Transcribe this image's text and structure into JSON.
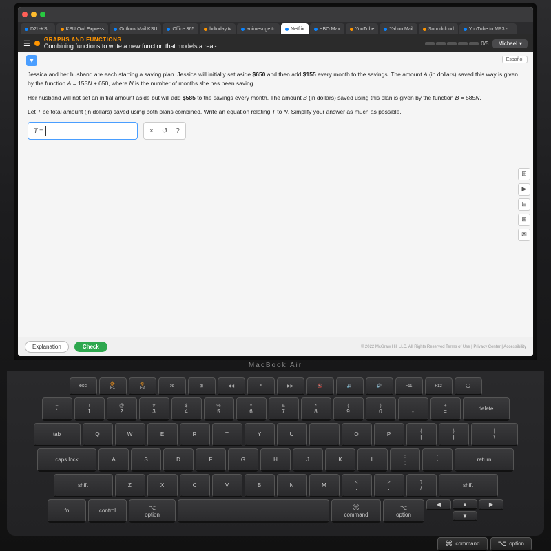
{
  "browser": {
    "tabs": [
      {
        "id": "d2l",
        "label": "D2L-KSU",
        "active": false,
        "dot": "blue"
      },
      {
        "id": "ksu",
        "label": "KSU Owl Express",
        "active": false,
        "dot": "orange"
      },
      {
        "id": "outlook",
        "label": "Outlook Mail KSU",
        "active": false,
        "dot": "blue"
      },
      {
        "id": "office",
        "label": "Office 365",
        "active": false,
        "dot": "blue"
      },
      {
        "id": "hd",
        "label": "hdtoday.tv",
        "active": false,
        "dot": "orange"
      },
      {
        "id": "anime",
        "label": "animesuge.to",
        "active": false,
        "dot": "blue"
      },
      {
        "id": "netflix",
        "label": "Netflix",
        "active": true,
        "dot": "blue"
      },
      {
        "id": "hbo",
        "label": "HBO Max",
        "active": false,
        "dot": "blue"
      },
      {
        "id": "yt",
        "label": "YouTube",
        "active": false,
        "dot": "orange"
      },
      {
        "id": "yahoo",
        "label": "Yahoo Mail",
        "active": false,
        "dot": "blue"
      },
      {
        "id": "sc",
        "label": "Soundcloud",
        "active": false,
        "dot": "orange"
      },
      {
        "id": "ytmp3",
        "label": "YouTube to MP3 -…",
        "active": false,
        "dot": "blue"
      }
    ]
  },
  "site": {
    "nav_section": "GRAPHS AND FUNCTIONS",
    "nav_title": "Combining functions to write a new function that models a real-...",
    "progress_filled": 0,
    "progress_total": 5,
    "progress_label": "0/5",
    "user_name": "Michael",
    "espanol_label": "Español"
  },
  "problem": {
    "expand_icon": "▾",
    "para1": "Jessica and her husband are each starting a saving plan. Jessica will initially set aside $650 and then add $155 every month to the savings. The amount A (in dollars) saved this way is given by the function A = 155N + 650, where N is the number of months she has been saving.",
    "para2": "Her husband will not set an initial amount aside but will add $585 to the savings every month. The amount B (in dollars) saved using this plan is given by the function B = 585N.",
    "para3": "Let T be total amount (in dollars) saved using both plans combined. Write an equation relating T to N. Simplify your answer as much as possible.",
    "equation_prefix": "T =",
    "equation_value": "",
    "symbol_x": "×",
    "symbol_undo": "↺",
    "symbol_help": "?"
  },
  "bottom": {
    "explanation_label": "Explanation",
    "check_label": "Check",
    "copyright": "© 2022 McGraw Hill LLC. All Rights Reserved   Terms of Use  |  Privacy Center  |  Accessibility"
  },
  "macbook": {
    "label": "MacBook Air"
  },
  "keyboard": {
    "fn_row": [
      "esc",
      "",
      "",
      "",
      "",
      "",
      "",
      "",
      "",
      "",
      "",
      "",
      "",
      "",
      ""
    ],
    "row1": [
      "~`",
      "!1",
      "@2",
      "#3",
      "$4",
      "%5",
      "^6",
      "&7",
      "*8",
      "(9",
      ")0",
      "_-",
      "+=",
      "delete"
    ],
    "row2": [
      "tab",
      "Q",
      "W",
      "E",
      "R",
      "T",
      "Y",
      "U",
      "I",
      "O",
      "P",
      "[{",
      "]}",
      "\\|"
    ],
    "row3": [
      "caps",
      "A",
      "S",
      "D",
      "F",
      "G",
      "H",
      "J",
      "K",
      "L",
      ";:",
      "'\"",
      "return"
    ],
    "row4": [
      "shift",
      "Z",
      "X",
      "C",
      "V",
      "B",
      "N",
      "M",
      ",<",
      ".>",
      "/?",
      "shift"
    ],
    "row5_left": [
      "fn",
      "control",
      "option",
      "command"
    ],
    "row5_right": [
      "command",
      "option"
    ],
    "command_label": "command",
    "option_label": "option",
    "cmd_icon": "⌘",
    "opt_icon": "⌥"
  }
}
